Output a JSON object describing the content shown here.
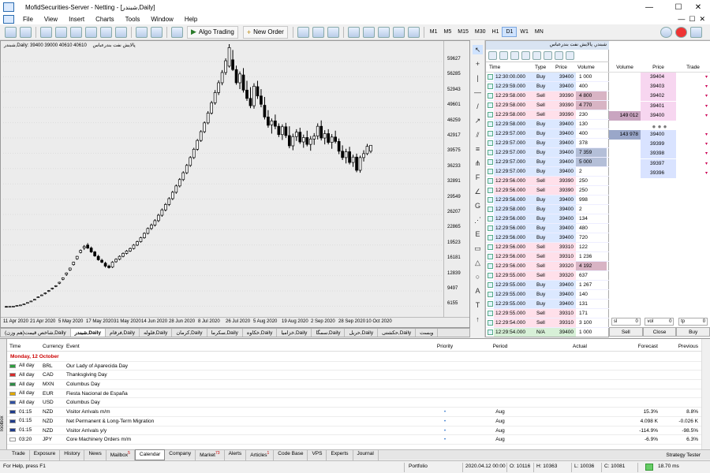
{
  "window": {
    "title": "MofidSecurities-Server - Netting - [شبندر,Daily]",
    "minimize": "—",
    "maximize": "☐",
    "close": "✕"
  },
  "menu": [
    "File",
    "View",
    "Insert",
    "Charts",
    "Tools",
    "Window",
    "Help"
  ],
  "toolbar": {
    "algo_trading": "Algo Trading",
    "new_order": "New Order",
    "timeframes": [
      "M1",
      "M5",
      "M15",
      "M30",
      "H1",
      "D1",
      "W1",
      "MN"
    ],
    "active_timeframe": "D1"
  },
  "chart": {
    "symbol_label": "شبندر,Daily: 39400 39000 40610 40610",
    "symbol_name": "پالایش نفت بندرعباس",
    "price_ticks": [
      "59627",
      "56285",
      "52943",
      "49601",
      "46259",
      "42917",
      "39575",
      "36233",
      "32891",
      "29549",
      "26207",
      "22865",
      "19523",
      "16181",
      "12839",
      "9497",
      "6155"
    ],
    "date_ticks": [
      "11 Apr 2020",
      "21 Apr 2020",
      "5 May 2020",
      "17 May 2020",
      "31 May 2020",
      "14 Jun 2020",
      "28 Jun 2020",
      "8 Jul 2020",
      "26 Jul 2020",
      "5 Aug 2020",
      "19 Aug 2020",
      "2 Sep 2020",
      "28 Sep 2020",
      "10 Oct 2020"
    ]
  },
  "chart_tabs": [
    "(هم وزن)شاخص قیمت,Daily",
    "شبندر,Daily",
    "فرقام,Daily",
    "فلوله,Daily",
    "کرمان,Daily",
    "سکرما,Daily",
    "خکاوه,Daily",
    "خزامیا,Daily",
    "سمگا,Daily",
    "حریل,Daily",
    "حکشتی,Daily",
    "وبست"
  ],
  "active_chart_tab": "شبندر,Daily",
  "time_sales": {
    "title": "شبندر, پالایش نفت بندرعباس",
    "headers": {
      "time": "Time",
      "type": "Type",
      "price": "Price",
      "volume": "Volume"
    },
    "rows": [
      {
        "time": "12:30:00.000",
        "type": "Buy",
        "price": "39400",
        "volume": "1 000"
      },
      {
        "time": "12:29:59.000",
        "type": "Buy",
        "price": "39400",
        "volume": "400"
      },
      {
        "time": "12:29:58.000",
        "type": "Sell",
        "price": "39390",
        "volume": "4 800"
      },
      {
        "time": "12:29:58.000",
        "type": "Sell",
        "price": "39390",
        "volume": "4 770"
      },
      {
        "time": "12:29:58.000",
        "type": "Sell",
        "price": "39390",
        "volume": "230"
      },
      {
        "time": "12:29:58.000",
        "type": "Buy",
        "price": "39400",
        "volume": "130"
      },
      {
        "time": "12:29:57.000",
        "type": "Buy",
        "price": "39400",
        "volume": "400"
      },
      {
        "time": "12:29:57.000",
        "type": "Buy",
        "price": "39400",
        "volume": "378"
      },
      {
        "time": "12:29:57.000",
        "type": "Buy",
        "price": "39400",
        "volume": "7 359"
      },
      {
        "time": "12:29:57.000",
        "type": "Buy",
        "price": "39400",
        "volume": "5 000"
      },
      {
        "time": "12:29:57.000",
        "type": "Buy",
        "price": "39400",
        "volume": "2"
      },
      {
        "time": "12:29:56.000",
        "type": "Sell",
        "price": "39390",
        "volume": "250"
      },
      {
        "time": "12:29:56.000",
        "type": "Sell",
        "price": "39390",
        "volume": "250"
      },
      {
        "time": "12:29:56.000",
        "type": "Buy",
        "price": "39400",
        "volume": "998"
      },
      {
        "time": "12:29:58.000",
        "type": "Buy",
        "price": "39400",
        "volume": "2"
      },
      {
        "time": "12:29:56.000",
        "type": "Buy",
        "price": "39400",
        "volume": "134"
      },
      {
        "time": "12:29:56.000",
        "type": "Buy",
        "price": "39400",
        "volume": "480"
      },
      {
        "time": "12:29:56.000",
        "type": "Buy",
        "price": "39400",
        "volume": "720"
      },
      {
        "time": "12:29:56.000",
        "type": "Sell",
        "price": "39310",
        "volume": "122"
      },
      {
        "time": "12:29:56.000",
        "type": "Sell",
        "price": "39310",
        "volume": "1 236"
      },
      {
        "time": "12:29:56.000",
        "type": "Sell",
        "price": "39320",
        "volume": "4 192"
      },
      {
        "time": "12:29:55.000",
        "type": "Sell",
        "price": "39320",
        "volume": "637"
      },
      {
        "time": "12:29:55.000",
        "type": "Buy",
        "price": "39400",
        "volume": "1 267"
      },
      {
        "time": "12:29:55.000",
        "type": "Buy",
        "price": "39400",
        "volume": "140"
      },
      {
        "time": "12:29:55.000",
        "type": "Buy",
        "price": "39400",
        "volume": "131"
      },
      {
        "time": "12:29:55.000",
        "type": "Sell",
        "price": "39310",
        "volume": "171"
      },
      {
        "time": "12:29:54.000",
        "type": "Sell",
        "price": "39310",
        "volume": "3 100"
      },
      {
        "time": "12:29:54.000",
        "type": "N/A",
        "price": "39400",
        "volume": "1 000"
      }
    ]
  },
  "depth": {
    "headers": {
      "volume": "Volume",
      "price": "Price",
      "trade": "Trade"
    },
    "asks": [
      {
        "volume": "",
        "price": "39404"
      },
      {
        "volume": "",
        "price": "39403"
      },
      {
        "volume": "",
        "price": "39402"
      },
      {
        "volume": "",
        "price": "39401"
      },
      {
        "volume": "149 012",
        "price": "39400"
      }
    ],
    "dots": "● ● ●",
    "bids": [
      {
        "volume": "143 978",
        "price": "39400"
      },
      {
        "volume": "",
        "price": "39399"
      },
      {
        "volume": "",
        "price": "39398"
      },
      {
        "volume": "",
        "price": "39397"
      },
      {
        "volume": "",
        "price": "39396"
      }
    ],
    "controls": [
      {
        "label": "sl",
        "value": "0"
      },
      {
        "label": "vol",
        "value": "0"
      },
      {
        "label": "tp",
        "value": "0"
      }
    ],
    "sell": "Sell",
    "close": "Close",
    "buy": "Buy"
  },
  "calendar": {
    "headers": {
      "time": "Time",
      "currency": "Currency",
      "event": "Event",
      "priority": "Priority",
      "period": "Period",
      "actual": "Actual",
      "forecast": "Forecast",
      "previous": "Previous"
    },
    "date": "Monday, 12 October",
    "rows": [
      {
        "time": "All day",
        "currency": "BRL",
        "event": "Our Lady of Aparecida Day",
        "priority": "",
        "period": "",
        "actual": "",
        "forecast": "",
        "previous": "",
        "flag": "#2e9e3e"
      },
      {
        "time": "All day",
        "currency": "CAD",
        "event": "Thanksgiving Day",
        "priority": "",
        "period": "",
        "actual": "",
        "forecast": "",
        "previous": "",
        "flag": "#d62b2b"
      },
      {
        "time": "All day",
        "currency": "MXN",
        "event": "Columbus Day",
        "priority": "",
        "period": "",
        "actual": "",
        "forecast": "",
        "previous": "",
        "flag": "#2e8b45"
      },
      {
        "time": "All day",
        "currency": "EUR",
        "event": "Fiesta Nacional de España",
        "priority": "",
        "period": "",
        "actual": "",
        "forecast": "",
        "previous": "",
        "flag": "#e0a800"
      },
      {
        "time": "All day",
        "currency": "USD",
        "event": "Columbus Day",
        "priority": "",
        "period": "",
        "actual": "",
        "forecast": "",
        "previous": "",
        "flag": "#3050a0"
      },
      {
        "time": "01:15",
        "currency": "NZD",
        "event": "Visitor Arrivals m/m",
        "priority": "•",
        "period": "Aug",
        "actual": "",
        "forecast": "15.3%",
        "previous": "8.8%",
        "flag": "#1f3a8a"
      },
      {
        "time": "01:15",
        "currency": "NZD",
        "event": "Net Permanent & Long-Term Migration",
        "priority": "•",
        "period": "Aug",
        "actual": "",
        "forecast": "4.098 K",
        "previous": "-0.026 K",
        "flag": "#1f3a8a"
      },
      {
        "time": "01:15",
        "currency": "NZD",
        "event": "Visitor Arrivals y/y",
        "priority": "•",
        "period": "Aug",
        "actual": "",
        "forecast": "-114.9%",
        "previous": "-98.5%",
        "flag": "#1f3a8a"
      },
      {
        "time": "03:20",
        "currency": "JPY",
        "event": "Core Machinery Orders m/m",
        "priority": "•",
        "period": "Aug",
        "actual": "",
        "forecast": "-6.9%",
        "previous": "6.3%",
        "flag": "#ffffff"
      }
    ]
  },
  "toolbox_label": "Toolbox",
  "bottom_tabs": [
    {
      "label": "Trade",
      "badge": ""
    },
    {
      "label": "Exposure",
      "badge": ""
    },
    {
      "label": "History",
      "badge": ""
    },
    {
      "label": "News",
      "badge": ""
    },
    {
      "label": "Mailbox",
      "badge": "5"
    },
    {
      "label": "Calendar",
      "badge": ""
    },
    {
      "label": "Company",
      "badge": ""
    },
    {
      "label": "Market",
      "badge": "73"
    },
    {
      "label": "Alerts",
      "badge": ""
    },
    {
      "label": "Articles",
      "badge": "1"
    },
    {
      "label": "Code Base",
      "badge": ""
    },
    {
      "label": "VPS",
      "badge": ""
    },
    {
      "label": "Experts",
      "badge": ""
    },
    {
      "label": "Journal",
      "badge": ""
    }
  ],
  "active_bottom_tab": "Calendar",
  "strategy_tester": "Strategy Tester",
  "status": {
    "help": "For Help, press F1",
    "profile": "Portfolio",
    "datetime": "2020.04.12 00:00",
    "open": "O: 10116",
    "high": "H: 10363",
    "low": "L: 10036",
    "close": "C: 10081",
    "traffic": "18.70 ms"
  },
  "chart_data": {
    "type": "candlestick",
    "title": "",
    "ylim": [
      6155,
      61298
    ],
    "candles": [
      [
        7650,
        7700,
        7500,
        7600
      ],
      [
        7600,
        7700,
        7500,
        7650
      ],
      [
        7700,
        7750,
        7600,
        7700
      ],
      [
        7800,
        7900,
        7700,
        7850
      ],
      [
        7900,
        8000,
        7800,
        7950
      ],
      [
        8100,
        8200,
        8000,
        8150
      ],
      [
        8400,
        8500,
        8300,
        8450
      ],
      [
        8700,
        8800,
        8600,
        8750
      ],
      [
        9000,
        9200,
        8900,
        9100
      ],
      [
        9500,
        9700,
        9400,
        9600
      ],
      [
        9900,
        10100,
        9800,
        10000
      ],
      [
        10300,
        10500,
        10100,
        10400
      ],
      [
        10800,
        11000,
        10600,
        10900
      ],
      [
        11300,
        11500,
        11100,
        11400
      ],
      [
        11800,
        12000,
        11600,
        11900
      ],
      [
        12400,
        12700,
        12200,
        12600
      ],
      [
        13200,
        13600,
        13000,
        13500
      ],
      [
        14200,
        14600,
        13900,
        14500
      ],
      [
        15100,
        15600,
        14900,
        15500
      ],
      [
        16200,
        16800,
        16000,
        16700
      ],
      [
        17400,
        18000,
        17200,
        17900
      ],
      [
        18700,
        19300,
        18500,
        19100
      ],
      [
        19600,
        20200,
        19200,
        19900
      ],
      [
        20200,
        20600,
        19400,
        19600
      ],
      [
        19600,
        19900,
        18600,
        18800
      ],
      [
        18800,
        19000,
        17800,
        18000
      ],
      [
        17900,
        18200,
        17000,
        17200
      ],
      [
        17100,
        17400,
        16500,
        16700
      ],
      [
        16500,
        16800,
        15600,
        15900
      ],
      [
        15900,
        16200,
        15400,
        15600
      ],
      [
        15700,
        16900,
        15500,
        16700
      ],
      [
        16800,
        17500,
        16600,
        17300
      ],
      [
        17300,
        18100,
        17100,
        17900
      ],
      [
        17900,
        18700,
        17700,
        18500
      ],
      [
        18500,
        19200,
        18300,
        19000
      ],
      [
        19000,
        19700,
        18800,
        19500
      ],
      [
        19500,
        20400,
        19300,
        20200
      ],
      [
        20200,
        21100,
        20000,
        20900
      ],
      [
        20900,
        21900,
        20700,
        21700
      ],
      [
        21700,
        22800,
        21500,
        22600
      ],
      [
        22600,
        23800,
        22400,
        23600
      ],
      [
        23600,
        24600,
        23300,
        24300
      ],
      [
        24300,
        25500,
        24000,
        25200
      ],
      [
        25200,
        26600,
        24900,
        26300
      ],
      [
        26300,
        27700,
        26000,
        27400
      ],
      [
        27400,
        28800,
        27100,
        28500
      ],
      [
        28500,
        30000,
        28200,
        29700
      ],
      [
        29700,
        31300,
        29400,
        31000
      ],
      [
        31000,
        32600,
        30700,
        32300
      ],
      [
        32300,
        33900,
        32000,
        33600
      ],
      [
        33600,
        35300,
        33300,
        35000
      ],
      [
        35000,
        36800,
        34700,
        36500
      ],
      [
        36500,
        38400,
        36200,
        38100
      ],
      [
        38100,
        40100,
        37800,
        39800
      ],
      [
        39800,
        41900,
        39500,
        41600
      ],
      [
        41600,
        43700,
        41300,
        43400
      ],
      [
        43400,
        45500,
        43100,
        45200
      ],
      [
        45200,
        47600,
        44900,
        47200
      ],
      [
        47200,
        49700,
        46900,
        49300
      ],
      [
        49300,
        51900,
        48900,
        51400
      ],
      [
        51400,
        53900,
        50900,
        53400
      ],
      [
        53400,
        56000,
        52900,
        55500
      ],
      [
        55500,
        58400,
        55000,
        57900
      ],
      [
        56800,
        61300,
        56500,
        60600
      ],
      [
        58100,
        60100,
        55800,
        56100
      ],
      [
        56100,
        56900,
        53000,
        53400
      ],
      [
        53400,
        55700,
        52100,
        55200
      ],
      [
        55000,
        56400,
        51400,
        51900
      ],
      [
        51900,
        53800,
        49700,
        50200
      ],
      [
        50200,
        52500,
        48200,
        48700
      ],
      [
        48700,
        53300,
        48100,
        52700
      ],
      [
        52600,
        53800,
        50100,
        50700
      ],
      [
        50700,
        52100,
        48400,
        49000
      ],
      [
        48800,
        50500,
        45900,
        46400
      ],
      [
        46400,
        47800,
        44200,
        44700
      ],
      [
        44800,
        46100,
        43000,
        45600
      ],
      [
        45600,
        46900,
        43900,
        44500
      ],
      [
        44500,
        45100,
        42300,
        42800
      ],
      [
        42800,
        44900,
        41700,
        44400
      ],
      [
        44400,
        45200,
        42100,
        42600
      ],
      [
        42600,
        44500,
        40000,
        40500
      ],
      [
        40500,
        43000,
        39600,
        42400
      ],
      [
        42400,
        43900,
        41500,
        43300
      ],
      [
        43300,
        44200,
        40900,
        41300
      ],
      [
        41300,
        42800,
        40100,
        42200
      ],
      [
        42200,
        43600,
        40400,
        40800
      ],
      [
        40800,
        42500,
        39500,
        41900
      ],
      [
        41900,
        43100,
        40700,
        42500
      ],
      [
        42500,
        45100,
        41800,
        44500
      ],
      [
        44500,
        45700,
        41600,
        42100
      ],
      [
        42100,
        43700,
        40800,
        43000
      ],
      [
        43000,
        43900,
        40800,
        41200
      ],
      [
        41200,
        42900,
        39900,
        42300
      ],
      [
        42300,
        43600,
        41000,
        41400
      ],
      [
        41400,
        42000,
        38800,
        39400
      ],
      [
        39400,
        40600,
        37600,
        38100
      ],
      [
        38100,
        39900,
        36900,
        39300
      ],
      [
        39300,
        40300,
        36700,
        37100
      ],
      [
        37100,
        38700,
        36200,
        38200
      ],
      [
        38200,
        38900,
        35100,
        35500
      ],
      [
        35500,
        38500,
        35000,
        38100
      ],
      [
        38100,
        39600,
        37300,
        38900
      ],
      [
        38900,
        40900,
        38600,
        40400
      ],
      [
        39400,
        40610,
        39000,
        40610
      ]
    ]
  }
}
